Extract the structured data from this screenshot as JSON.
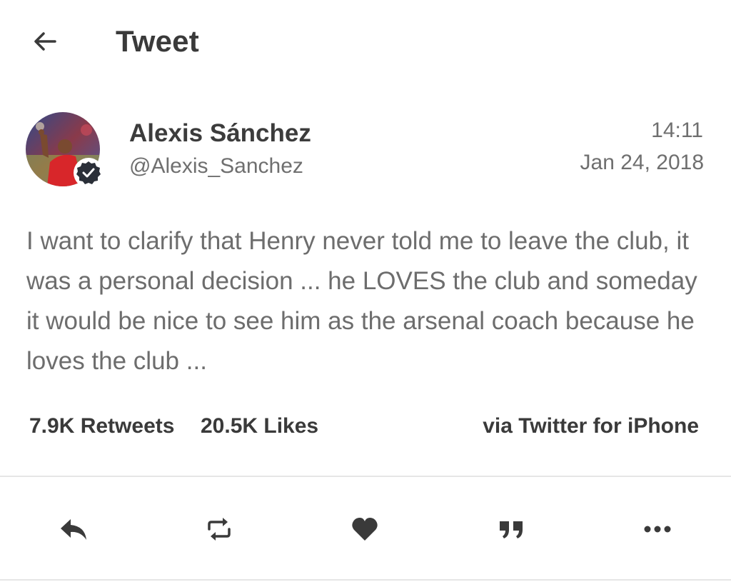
{
  "header": {
    "back_icon": "arrow-left-icon",
    "title": "Tweet"
  },
  "author": {
    "name": "Alexis Sánchez",
    "handle": "@Alexis_Sanchez",
    "avatar_icon": "profile-photo",
    "verified_icon": "verified-check-icon"
  },
  "timestamp": {
    "time": "14:11",
    "date": "Jan 24, 2018"
  },
  "tweet": {
    "text": "I want to clarify that Henry never told me to leave the club, it was a personal decision ... he LOVES the club and someday it would be nice to see him as the arsenal coach because he loves the club ..."
  },
  "stats": {
    "retweets": "7.9K Retweets",
    "likes": "20.5K Likes",
    "source": "via Twitter for iPhone"
  },
  "actions": {
    "reply_icon": "reply-icon",
    "retweet_icon": "retweet-icon",
    "like_icon": "heart-icon",
    "quote_icon": "quote-icon",
    "more_icon": "more-icon"
  },
  "colors": {
    "primary_text": "#3a3a3a",
    "secondary_text": "#6f6f6f",
    "icon": "#3a3a3a",
    "divider": "#e6e6e6"
  }
}
